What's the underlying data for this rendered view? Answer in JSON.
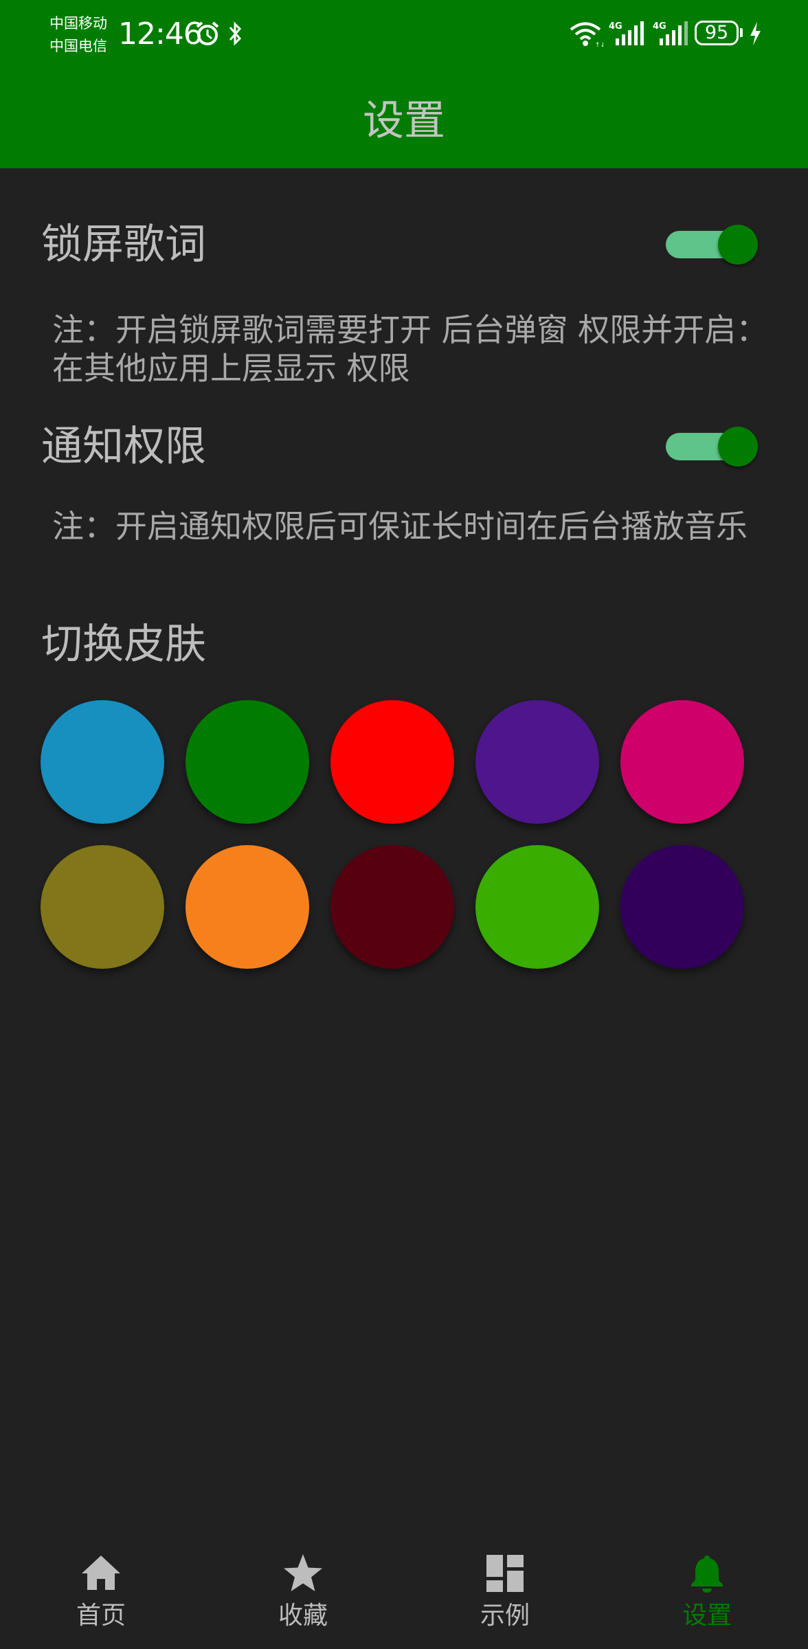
{
  "status_bar": {
    "carrier_1": "中国移动",
    "carrier_2": "中国电信",
    "time": "12:46",
    "signal_1_label": "4G",
    "signal_2_label": "4G",
    "battery_level": "95"
  },
  "header": {
    "title": "设置",
    "color": "#017c00"
  },
  "settings": {
    "lock_lyrics": {
      "label": "锁屏歌词",
      "enabled": true,
      "note": "注：开启锁屏歌词需要打开 后台弹窗 权限并开启：在其他应用上层显示 权限"
    },
    "notification": {
      "label": "通知权限",
      "enabled": true,
      "note": "注：开启通知权限后可保证长时间在后台播放音乐"
    }
  },
  "skins": {
    "title": "切换皮肤",
    "colors": [
      "#178fbf",
      "#017c00",
      "#ff0000",
      "#4e158d",
      "#d0006a",
      "#817619",
      "#f6811c",
      "#570010",
      "#39ad00",
      "#32005b"
    ]
  },
  "bottom_nav": {
    "active_color": "#017c00",
    "inactive_color": "#bdbdbd",
    "items": [
      {
        "label": "首页",
        "icon": "home-icon",
        "active": false
      },
      {
        "label": "收藏",
        "icon": "star-icon",
        "active": false
      },
      {
        "label": "示例",
        "icon": "dashboard-icon",
        "active": false
      },
      {
        "label": "设置",
        "icon": "bell-icon",
        "active": true
      }
    ]
  }
}
